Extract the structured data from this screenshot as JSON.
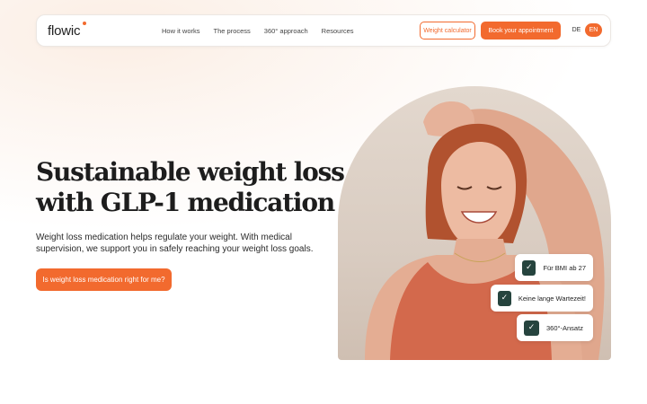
{
  "brand": {
    "name": "flowic",
    "accent": "#f26a2e",
    "dark_green": "#26443e"
  },
  "nav": {
    "links": [
      "How it works",
      "The process",
      "360° approach",
      "Resources"
    ],
    "weight_calculator": "Weight calculator",
    "book": "Book your appointment",
    "languages": [
      "DE",
      "EN"
    ],
    "active_language": "EN"
  },
  "hero": {
    "title_line1": "Sustainable weight loss",
    "title_line2": "with GLP-1 medication",
    "subtitle": "Weight loss medication helps regulate your weight. With medical supervision, we support you in safely reaching your weight loss goals.",
    "cta": "Is weight loss medication right for me?"
  },
  "badges": [
    {
      "icon": "check-icon",
      "label": "Für BMI ab 27"
    },
    {
      "icon": "check-icon",
      "label": "Keine lange Wartezeit!"
    },
    {
      "icon": "check-icon",
      "label": "360°-Ansatz"
    }
  ],
  "icons": {
    "check": "✓"
  }
}
